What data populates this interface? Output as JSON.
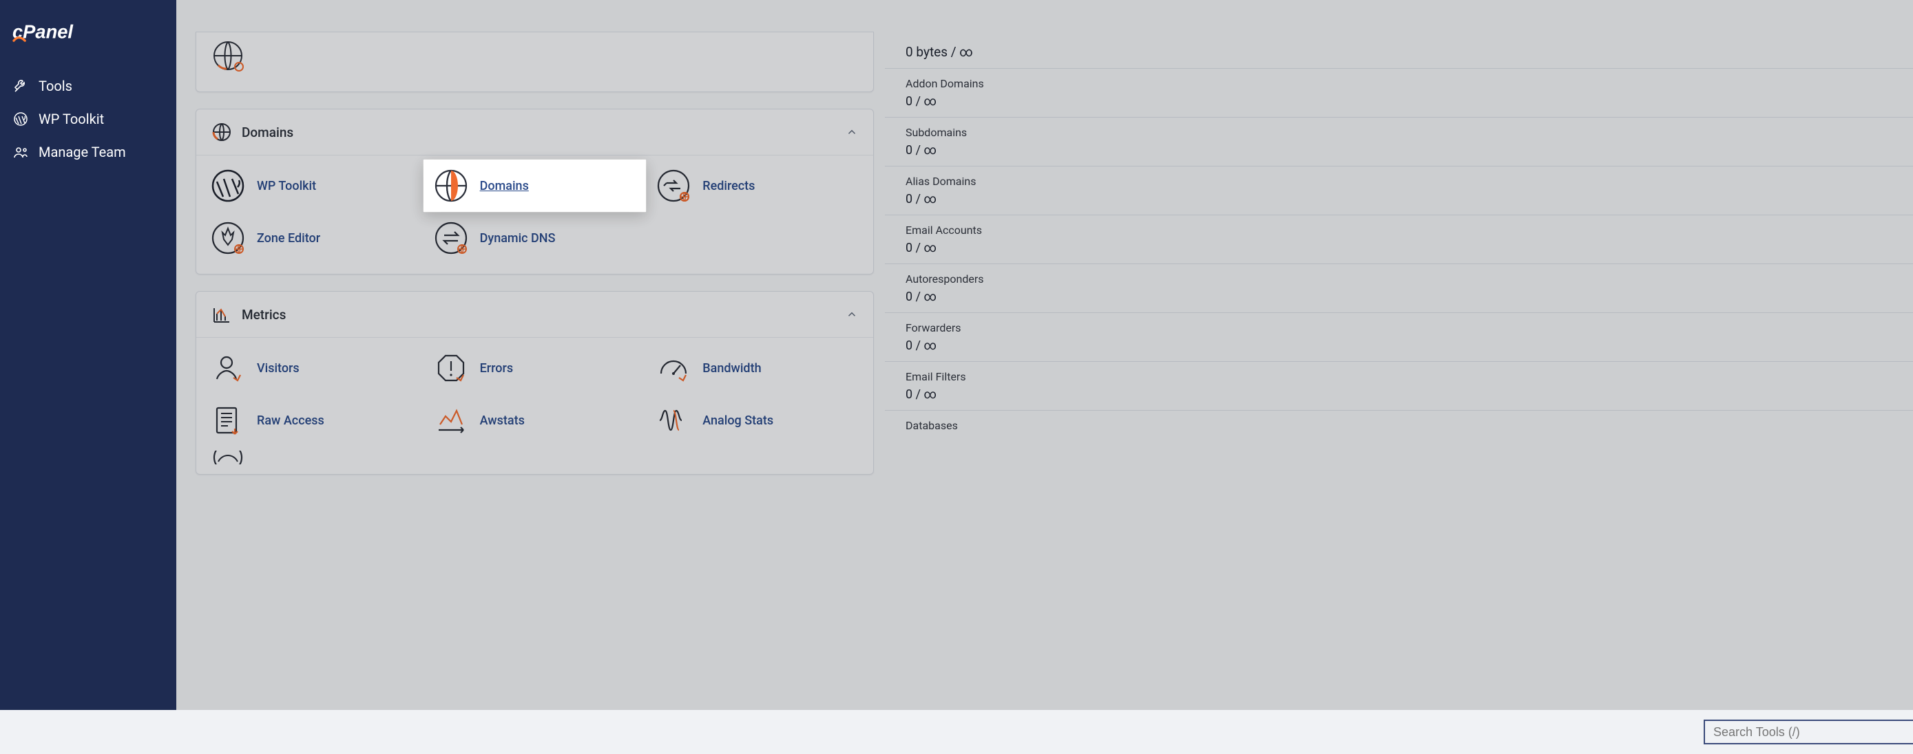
{
  "brand": {
    "name": "cPanel"
  },
  "search": {
    "placeholder": "Search Tools (/)"
  },
  "sidebar": {
    "items": [
      {
        "label": "Tools"
      },
      {
        "label": "WP Toolkit"
      },
      {
        "label": "Manage Team"
      }
    ]
  },
  "partial_panel_icon": "globe-icon",
  "panels": [
    {
      "title": "Domains",
      "header_icon": "globe-icon",
      "items": [
        {
          "label": "WP Toolkit",
          "icon": "wordpress-icon",
          "highlighted": false
        },
        {
          "label": "Domains",
          "icon": "globe-icon",
          "highlighted": true
        },
        {
          "label": "Redirects",
          "icon": "redirect-icon",
          "highlighted": false
        },
        {
          "label": "Zone Editor",
          "icon": "zone-icon",
          "highlighted": false
        },
        {
          "label": "Dynamic DNS",
          "icon": "ddns-icon",
          "highlighted": false
        }
      ]
    },
    {
      "title": "Metrics",
      "header_icon": "chart-icon",
      "items": [
        {
          "label": "Visitors",
          "icon": "visitors-icon",
          "highlighted": false
        },
        {
          "label": "Errors",
          "icon": "errors-icon",
          "highlighted": false
        },
        {
          "label": "Bandwidth",
          "icon": "bandwidth-icon",
          "highlighted": false
        },
        {
          "label": "Raw Access",
          "icon": "rawaccess-icon",
          "highlighted": false
        },
        {
          "label": "Awstats",
          "icon": "awstats-icon",
          "highlighted": false
        },
        {
          "label": "Analog Stats",
          "icon": "analog-icon",
          "highlighted": false
        }
      ]
    }
  ],
  "stats_top_value": "0 bytes / ∞",
  "stats": [
    {
      "label": "Addon Domains",
      "value": "0 / ∞"
    },
    {
      "label": "Subdomains",
      "value": "0 / ∞"
    },
    {
      "label": "Alias Domains",
      "value": "0 / ∞"
    },
    {
      "label": "Email Accounts",
      "value": "0 / ∞"
    },
    {
      "label": "Autoresponders",
      "value": "0 / ∞"
    },
    {
      "label": "Forwarders",
      "value": "0 / ∞"
    },
    {
      "label": "Email Filters",
      "value": "0 / ∞"
    },
    {
      "label": "Databases",
      "value": ""
    }
  ]
}
